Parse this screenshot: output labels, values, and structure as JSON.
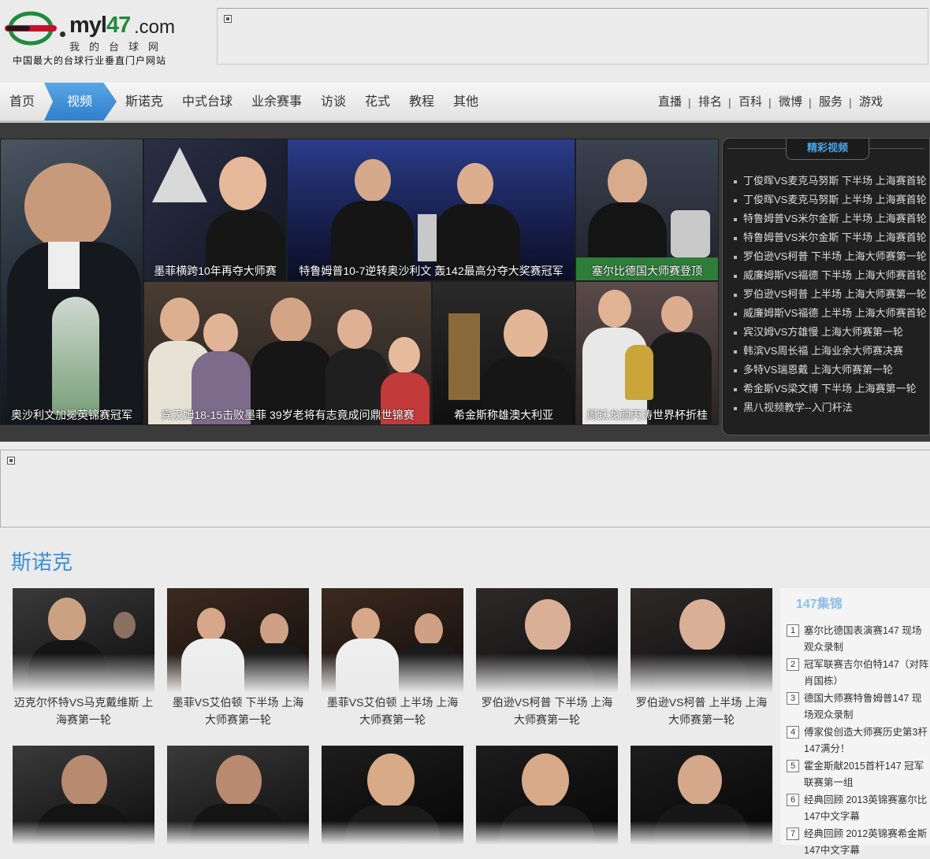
{
  "header": {
    "logo_word_prefix": "myl",
    "logo_word_number": "47",
    "logo_dotcom": ".com",
    "logo_cn": "我的台球网",
    "slogan": "中国最大的台球行业垂直门户网站"
  },
  "nav": {
    "items": [
      "首页",
      "视频",
      "斯诺克",
      "中式台球",
      "业余赛事",
      "访谈",
      "花式",
      "教程",
      "其他"
    ],
    "active": "视频",
    "right": [
      "直播",
      "排名",
      "百科",
      "微博",
      "服务",
      "游戏"
    ],
    "separator": "|"
  },
  "focus": {
    "photos": [
      {
        "caption": "奥沙利文加冕英锦赛冠军"
      },
      {
        "caption": "墨菲横跨10年再夺大师赛"
      },
      {
        "caption": "特鲁姆普10-7逆转奥沙利文 轰142最高分夺大奖赛冠军"
      },
      {
        "caption": "塞尔比德国大师赛登顶"
      },
      {
        "caption": "宾汉姆18-15击败墨菲 39岁老将有志竟成问鼎世锦赛"
      },
      {
        "caption": "希金斯称雄澳大利亚"
      },
      {
        "caption": "周跃龙颜丙涛世界杯折桂"
      }
    ]
  },
  "video_panel": {
    "title": "精彩视频",
    "items": [
      "丁俊晖VS麦克马努斯 下半场 上海赛首轮",
      "丁俊晖VS麦克马努斯 上半场 上海赛首轮",
      "特鲁姆普VS米尔金斯 上半场 上海赛首轮",
      "特鲁姆普VS米尔金斯 下半场 上海赛首轮",
      "罗伯逊VS柯普 下半场 上海大师赛第一轮",
      "威廉姆斯VS福德 下半场 上海大师赛首轮",
      "罗伯逊VS柯普 上半场 上海大师赛第一轮",
      "威廉姆斯VS福德 上半场 上海大师赛首轮",
      "宾汉姆VS方雄慢 上海大师赛第一轮",
      "韩滨VS周长福 上海业余大师赛决赛",
      "多特VS瑞恩戴 上海大师赛第一轮",
      "希金斯VS梁文博 下半场 上海赛第一轮",
      "黑八视频教学--入门杆法"
    ]
  },
  "snooker": {
    "title": "斯诺克",
    "cards": [
      {
        "title": "迈克尔怀特VS马克戴维斯 上海赛第一轮"
      },
      {
        "title": "墨菲VS艾伯顿 下半场 上海大师赛第一轮"
      },
      {
        "title": "墨菲VS艾伯顿 上半场 上海大师赛第一轮"
      },
      {
        "title": "罗伯逊VS柯普 下半场 上海大师赛第一轮"
      },
      {
        "title": "罗伯逊VS柯普 上半场 上海大师赛第一轮"
      },
      {
        "title": ""
      },
      {
        "title": ""
      },
      {
        "title": ""
      },
      {
        "title": ""
      },
      {
        "title": ""
      }
    ]
  },
  "highlights": {
    "title": "147集锦",
    "items": [
      {
        "num": "1",
        "text": "塞尔比德国表演赛147 现场观众录制"
      },
      {
        "num": "2",
        "text": "冠军联赛吉尔伯特147（对阵肖国栋）"
      },
      {
        "num": "3",
        "text": "德国大师赛特鲁姆普147 现场观众录制"
      },
      {
        "num": "4",
        "text": "傅家俊创造大师赛历史第3杆147满分！"
      },
      {
        "num": "5",
        "text": "霍金斯献2015首杆147 冠军联赛第一组"
      },
      {
        "num": "6",
        "text": "经典回顾 2013英锦赛塞尔比147中文字幕"
      },
      {
        "num": "7",
        "text": "经典回顾 2012英锦赛希金斯147中文字幕"
      }
    ]
  },
  "colors": {
    "accent": "#3a8fd6",
    "nav_active": "#3a8ad6",
    "band": "#3b3b3b",
    "panel": "#202020"
  }
}
